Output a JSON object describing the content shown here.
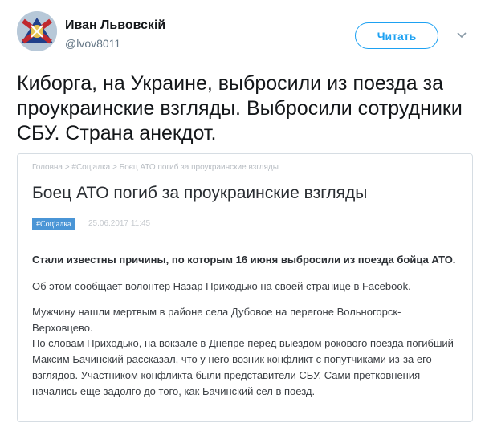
{
  "author": {
    "name": "Иван Львовскій",
    "handle": "@lvov8011"
  },
  "actions": {
    "follow_label": "Читать"
  },
  "tweet": {
    "text": "Киборга, на Украине, выбросили из поезда за проукраинские взгляды. Выбросили сотрудники СБУ. Страна анекдот."
  },
  "card": {
    "breadcrumb": "Головна > #Соціалка > Боєц АТО погиб за проукраинские взгляды",
    "title": "Боец АТО погиб за проукраинские взгляды",
    "tag": "#Соціалка",
    "date": "25.06.2017 11:45",
    "lead": "Стали известны причины, по которым 16 июня выбросили из поезда бойца АТО.",
    "paragraphs": [
      "Об этом сообщает волонтер Назар Приходько на своей странице в Facebook.",
      "Мужчину нашли мертвым в районе села Дубовое на перегоне Вольногорск-Верховцево.",
      "По словам Приходько, на вокзале в Днепре перед выездом рокового поезда погибший Максим Бачинский рассказал, что у него возник конфликт с попутчиками из-за его взглядов. Участником конфликта были представители СБУ. Сами претковнения начались еще задолго до того, как Бачинский сел в поезд."
    ]
  },
  "colors": {
    "accent": "#1da1f2",
    "tag_bg": "#4a95d6",
    "secondary_text": "#657786"
  },
  "icons": {
    "menu": "chevron-down-icon"
  }
}
